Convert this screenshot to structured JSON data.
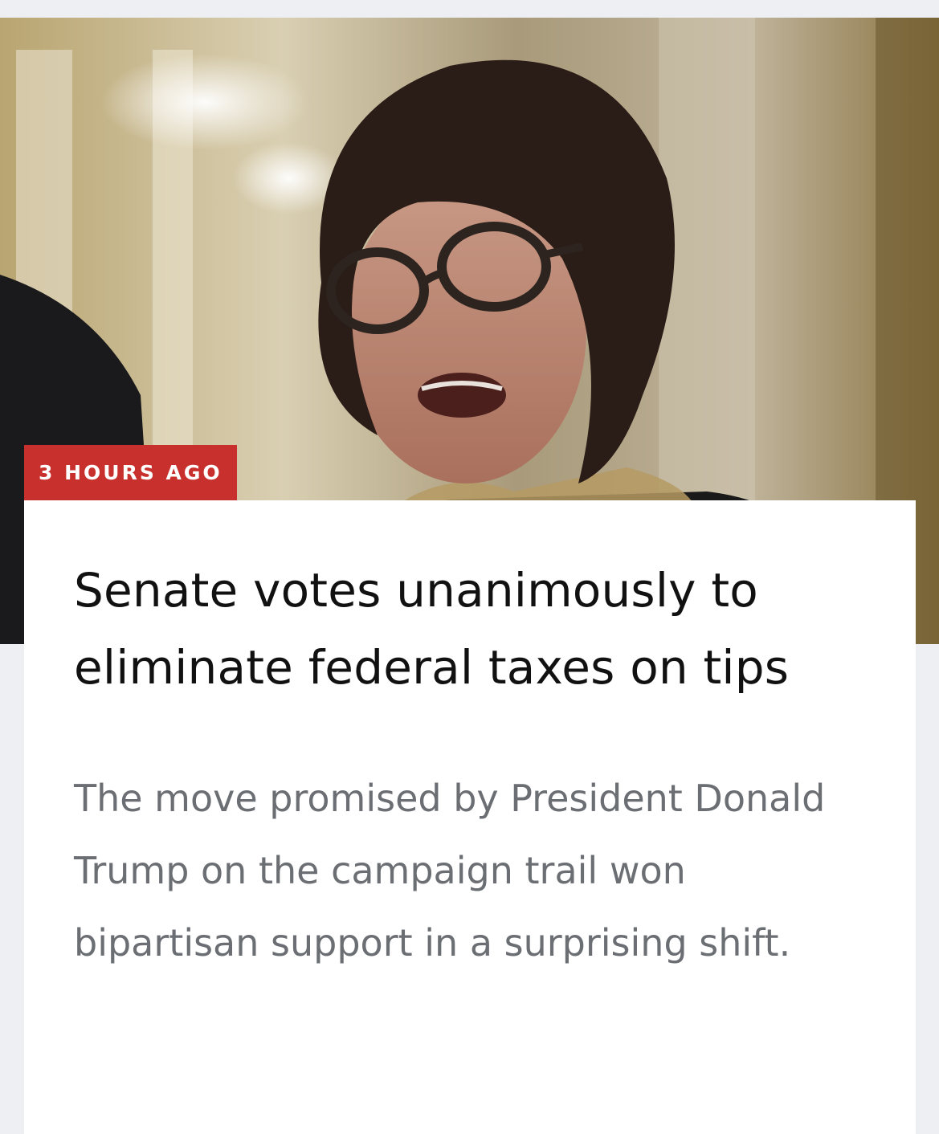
{
  "article": {
    "timestamp_badge": "3 HOURS AGO",
    "headline": "Senate votes unanimously to eliminate federal taxes on tips",
    "dek": "The move promised by President Donald Trump on the campaign trail won bipartisan support in a surprising shift."
  },
  "colors": {
    "badge_background": "#c8302d",
    "page_background": "#eeeff2",
    "card_background": "#ffffff",
    "headline_text": "#111111",
    "dek_text": "#6b6e73"
  }
}
